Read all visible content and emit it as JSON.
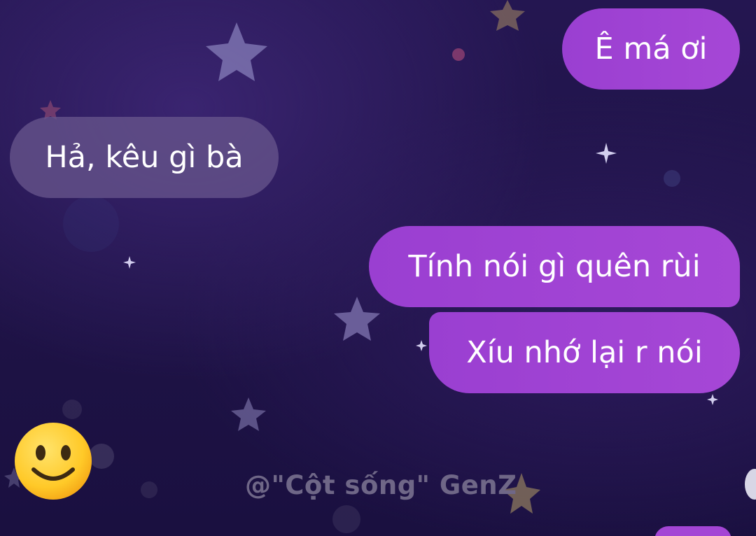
{
  "messages": [
    {
      "side": "outgoing",
      "text": "Ê má ơi"
    },
    {
      "side": "incoming",
      "text": "Hả, kêu gì bà"
    },
    {
      "side": "outgoing",
      "text": "Tính nói gì quên rùi"
    },
    {
      "side": "outgoing",
      "text": "Xíu nhớ lại r nói"
    }
  ],
  "reaction_emoji": "slightly-smiling-face-icon",
  "watermark": "@\"Cột sống\" GenZ",
  "colors": {
    "background": "#211448",
    "outgoing_bubble": "#a043d3",
    "incoming_bubble": "#5f4d85",
    "text": "#ffffff",
    "watermark": "#6f6787"
  }
}
